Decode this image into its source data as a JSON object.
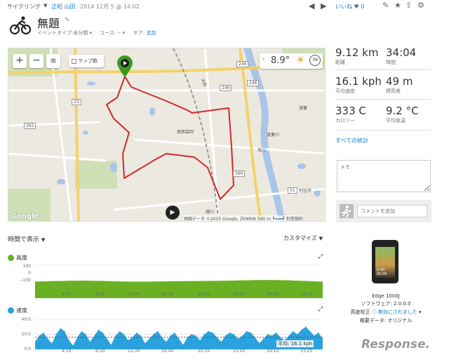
{
  "header": {
    "activity_type": "サイクリング",
    "user": "正昭 山田",
    "date": "2014 12月 5 @ 14:02",
    "like_label": "いいね",
    "like_count": "0"
  },
  "activity": {
    "title": "無題",
    "event_type_label": "イベントタイプ:",
    "event_type_value": "未分類",
    "course_label": "コース:",
    "course_value": "--",
    "gear_label": "ギア:",
    "gear_value": "追加"
  },
  "map": {
    "lap_label": "ラップ数",
    "temperature": "8.9°",
    "wind_value": "39",
    "zoom_in": "+",
    "zoom_out": "−",
    "logo": "Google",
    "attribution": "地図データ ©2015 Google, ZENRIN   500 m ┗━━━┛   利用規約",
    "route_color": "#d32a2a",
    "roads": {
      "r246a": "246",
      "r246b": "246",
      "r246c": "246",
      "r23": "23",
      "r262": "262",
      "r366": "366",
      "r51": "51"
    },
    "places": {
      "p1": "尾張森岡",
      "p2": "緒川",
      "p3": "刈谷市",
      "p4": "境川",
      "p5": "逢妻川",
      "p6": "速妻",
      "p7": "大府"
    }
  },
  "stats": [
    {
      "value": "9.12 km",
      "label": "距離"
    },
    {
      "value": "34:04",
      "label": "時間"
    },
    {
      "value": "16.1 kph",
      "label": "平均速度"
    },
    {
      "value": "49 m",
      "label": "標高差"
    },
    {
      "value": "333 C",
      "label": "カロリー"
    },
    {
      "value": "9.2 °C",
      "label": "平均気温"
    }
  ],
  "all_stats_link": "すべての統計",
  "memo_placeholder": "メモ",
  "comment_placeholder": "コメントを追加",
  "timeline": {
    "view_label": "時間で表示",
    "customize_label": "カスタマイズ"
  },
  "elevation_chart": {
    "title": "高度",
    "color": "#6ab023"
  },
  "speed_chart": {
    "title": "速度",
    "color": "#2aa2dd",
    "avg_label": "平均: 16.1 kph"
  },
  "chart_data": [
    {
      "type": "area",
      "title": "高度",
      "y_ticks": [
        "100",
        "0",
        "−100"
      ],
      "x_ticks": [
        "4:10",
        "8:20",
        "12:30",
        "16:40",
        "20:50",
        "25:00",
        "29:10",
        "33:20"
      ],
      "ylim": [
        -100,
        100
      ],
      "x": [
        0,
        2,
        4,
        6,
        8,
        10,
        12,
        14,
        16,
        18,
        20,
        22,
        24,
        26,
        28,
        30,
        32,
        34
      ],
      "values": [
        -2,
        1,
        3,
        4,
        2,
        -1,
        -3,
        -2,
        0,
        1,
        2,
        3,
        5,
        7,
        8,
        6,
        2,
        -3
      ]
    },
    {
      "type": "area",
      "title": "速度",
      "y_ticks": [
        "40.0",
        "20.0",
        "0.0"
      ],
      "x_ticks": [
        "4:10",
        "8:20",
        "12:30",
        "16:40",
        "20:50",
        "25:00",
        "29:10",
        "33:20"
      ],
      "ylim": [
        0,
        40
      ],
      "average": 16.1,
      "x": [
        0,
        0.5,
        1,
        1.5,
        2,
        2.5,
        3,
        3.5,
        4,
        4.5,
        5,
        5.5,
        6,
        6.5,
        7,
        7.5,
        8,
        8.5,
        9,
        9.5,
        10,
        10.5,
        11,
        11.5,
        12,
        12.5,
        13,
        13.5,
        14,
        14.5,
        15,
        15.5,
        16,
        16.5,
        17,
        17.5,
        18,
        18.5,
        19,
        19.5,
        20,
        20.5,
        21,
        21.5,
        22,
        22.5,
        23,
        23.5,
        24,
        24.5,
        25,
        25.5,
        26,
        26.5,
        27,
        27.5,
        28,
        28.5,
        29,
        29.5,
        30,
        30.5,
        31,
        31.5,
        32,
        32.5,
        33,
        33.5,
        34
      ],
      "values": [
        10,
        18,
        22,
        14,
        8,
        20,
        28,
        24,
        12,
        5,
        16,
        24,
        20,
        10,
        18,
        26,
        22,
        14,
        6,
        18,
        24,
        20,
        12,
        16,
        22,
        18,
        8,
        14,
        20,
        24,
        16,
        10,
        18,
        22,
        14,
        6,
        16,
        20,
        18,
        12,
        20,
        24,
        22,
        16,
        10,
        18,
        22,
        20,
        14,
        18,
        24,
        22,
        16,
        8,
        14,
        20,
        18,
        22,
        16,
        12,
        18,
        24,
        20,
        26,
        30,
        24,
        18,
        22,
        14
      ]
    }
  ],
  "device": {
    "name": "Edge 1000J",
    "software": "ソフトウェア: 2.0.0.0",
    "elev_correct_label": "高度校正",
    "elev_correct_value": "無効にされました",
    "profile": "概要データ: オリジナル",
    "screen_text": "0.00 00:00"
  },
  "watermark": "Response."
}
